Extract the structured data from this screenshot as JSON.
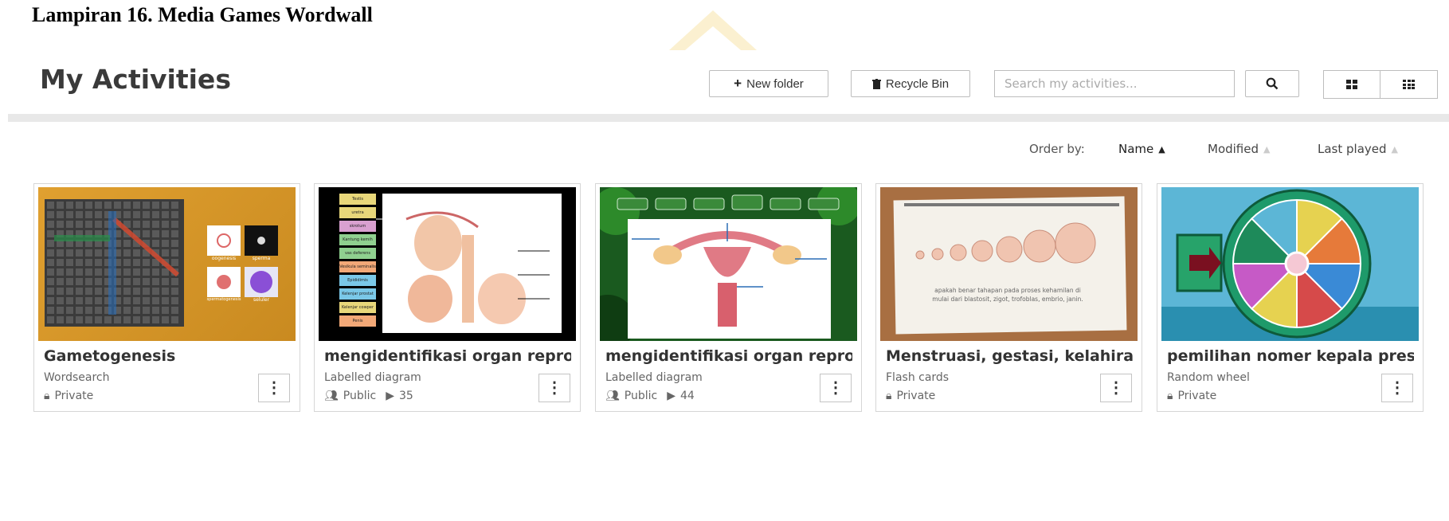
{
  "caption": "Lampiran 16. Media Games Wordwall",
  "page_title": "My Activities",
  "toolbar": {
    "new_folder": "New folder",
    "recycle_bin": "Recycle Bin",
    "search_placeholder": "Search my activities..."
  },
  "order": {
    "label": "Order by:",
    "name": "Name",
    "modified": "Modified",
    "last_played": "Last played"
  },
  "cards": [
    {
      "title": "Gametogenesis",
      "type": "Wordsearch",
      "visibility": "Private",
      "plays": ""
    },
    {
      "title": "mengidentifikasi organ reproduksi",
      "type": "Labelled diagram",
      "visibility": "Public",
      "plays": "35"
    },
    {
      "title": "mengidentifikasi organ reproduksi",
      "type": "Labelled diagram",
      "visibility": "Public",
      "plays": "44"
    },
    {
      "title": "Menstruasi, gestasi, kelahiran",
      "type": "Flash cards",
      "visibility": "Private",
      "plays": ""
    },
    {
      "title": "pemilihan nomer kepala presensi",
      "type": "Random wheel",
      "visibility": "Private",
      "plays": ""
    }
  ],
  "thumbs": {
    "wordsearch": [
      "oogenesis",
      "sperma",
      "spermatogenesis",
      "seluler"
    ],
    "male_labels": [
      "Testis",
      "uretra",
      "skrotum",
      "Kantung kemih",
      "vas deferens",
      "Vesikula seminalis",
      "Epididimis",
      "Kelenjar prostat",
      "Kelenjar cowper",
      "Penis"
    ],
    "flash_text": "apakah benar tahapan pada proses kehamilan di mulai dari blastosit, zigot, trofoblas, embrio, janin."
  }
}
